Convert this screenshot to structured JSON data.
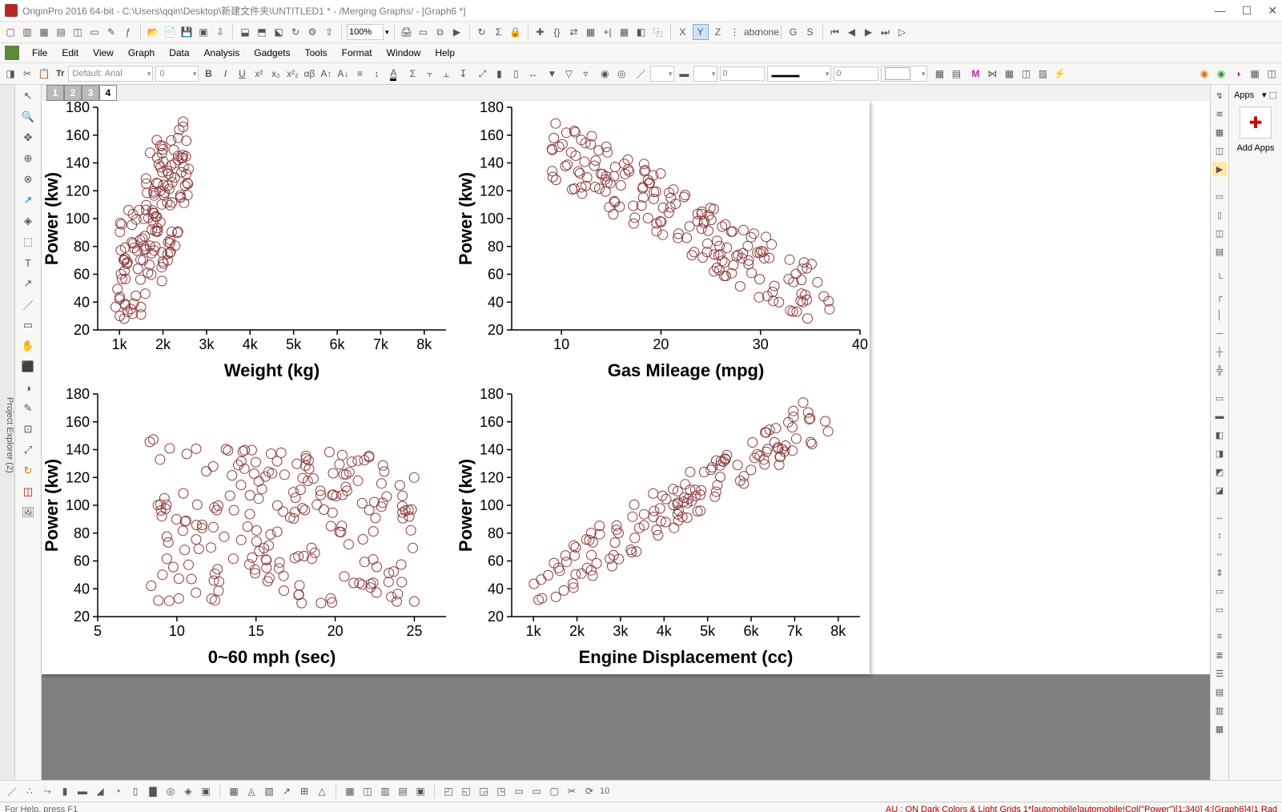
{
  "title": "OriginPro 2016 64-bit - C:\\Users\\qqin\\Desktop\\新建文件夹\\UNTITLED1 * - /Merging Graphs/ - [Graph6 *]",
  "zoom": "100%",
  "menus": [
    "File",
    "Edit",
    "View",
    "Graph",
    "Data",
    "Analysis",
    "Gadgets",
    "Tools",
    "Format",
    "Window",
    "Help"
  ],
  "font_default": "Default: Arial",
  "font_size": "0",
  "layer_tabs": [
    "1",
    "2",
    "3",
    "4"
  ],
  "active_layer": "4",
  "apps": {
    "header": "Apps",
    "add_label": "Add Apps"
  },
  "toolbar3": {
    "num1": "0",
    "num2": "0",
    "pensize": "10"
  },
  "status_left": "For Help, press F1",
  "status_right": "AU : ON  Dark Colors & Light Grids  1*[automobile]automobile!Col(\"Power\")[1:340]  4:[Graph6]4!1  Rad",
  "chart_data": [
    {
      "type": "scatter",
      "title": "",
      "xlabel": "Weight (kg)",
      "ylabel": "Power (kw)",
      "xlim": [
        500,
        8500
      ],
      "ylim": [
        20,
        180
      ],
      "xticks": [
        1000,
        2000,
        3000,
        4000,
        5000,
        6000,
        7000,
        8000
      ],
      "xticklabels": [
        "1k",
        "2k",
        "3k",
        "4k",
        "5k",
        "6k",
        "7k",
        "8k"
      ],
      "yticks": [
        20,
        40,
        60,
        80,
        100,
        120,
        140,
        160,
        180
      ],
      "seed": 11,
      "n": 160,
      "gen": {
        "xr": [
          900,
          2600
        ],
        "fn": "kw_vs_weight"
      }
    },
    {
      "type": "scatter",
      "title": "",
      "xlabel": "Gas Mileage (mpg)",
      "ylabel": "Power (kw)",
      "xlim": [
        5,
        40
      ],
      "ylim": [
        20,
        180
      ],
      "xticks": [
        10,
        20,
        30,
        40
      ],
      "xticklabels": [
        "10",
        "20",
        "30",
        "40"
      ],
      "yticks": [
        20,
        40,
        60,
        80,
        100,
        120,
        140,
        160,
        180
      ],
      "seed": 22,
      "n": 180,
      "gen": {
        "xr": [
          9,
          37
        ],
        "fn": "kw_vs_mpg"
      }
    },
    {
      "type": "scatter",
      "title": "",
      "xlabel": "0~60 mph (sec)",
      "ylabel": "Power (kw)",
      "xlim": [
        5,
        27
      ],
      "ylim": [
        20,
        180
      ],
      "xticks": [
        5,
        10,
        15,
        20,
        25
      ],
      "xticklabels": [
        "5",
        "10",
        "15",
        "20",
        "25"
      ],
      "yticks": [
        20,
        40,
        60,
        80,
        100,
        120,
        140,
        160,
        180
      ],
      "seed": 33,
      "n": 220,
      "gen": {
        "xr": [
          8,
          25
        ],
        "fn": "kw_vs_060"
      }
    },
    {
      "type": "scatter",
      "title": "",
      "xlabel": "Engine Displacement (cc)",
      "ylabel": "Power (kw)",
      "xlim": [
        500,
        8500
      ],
      "ylim": [
        20,
        180
      ],
      "xticks": [
        1000,
        2000,
        3000,
        4000,
        5000,
        6000,
        7000,
        8000
      ],
      "xticklabels": [
        "1k",
        "2k",
        "3k",
        "4k",
        "5k",
        "6k",
        "7k",
        "8k"
      ],
      "yticks": [
        20,
        40,
        60,
        80,
        100,
        120,
        140,
        160,
        180
      ],
      "seed": 44,
      "n": 140,
      "gen": {
        "xr": [
          900,
          7800
        ],
        "fn": "kw_vs_disp"
      }
    }
  ]
}
